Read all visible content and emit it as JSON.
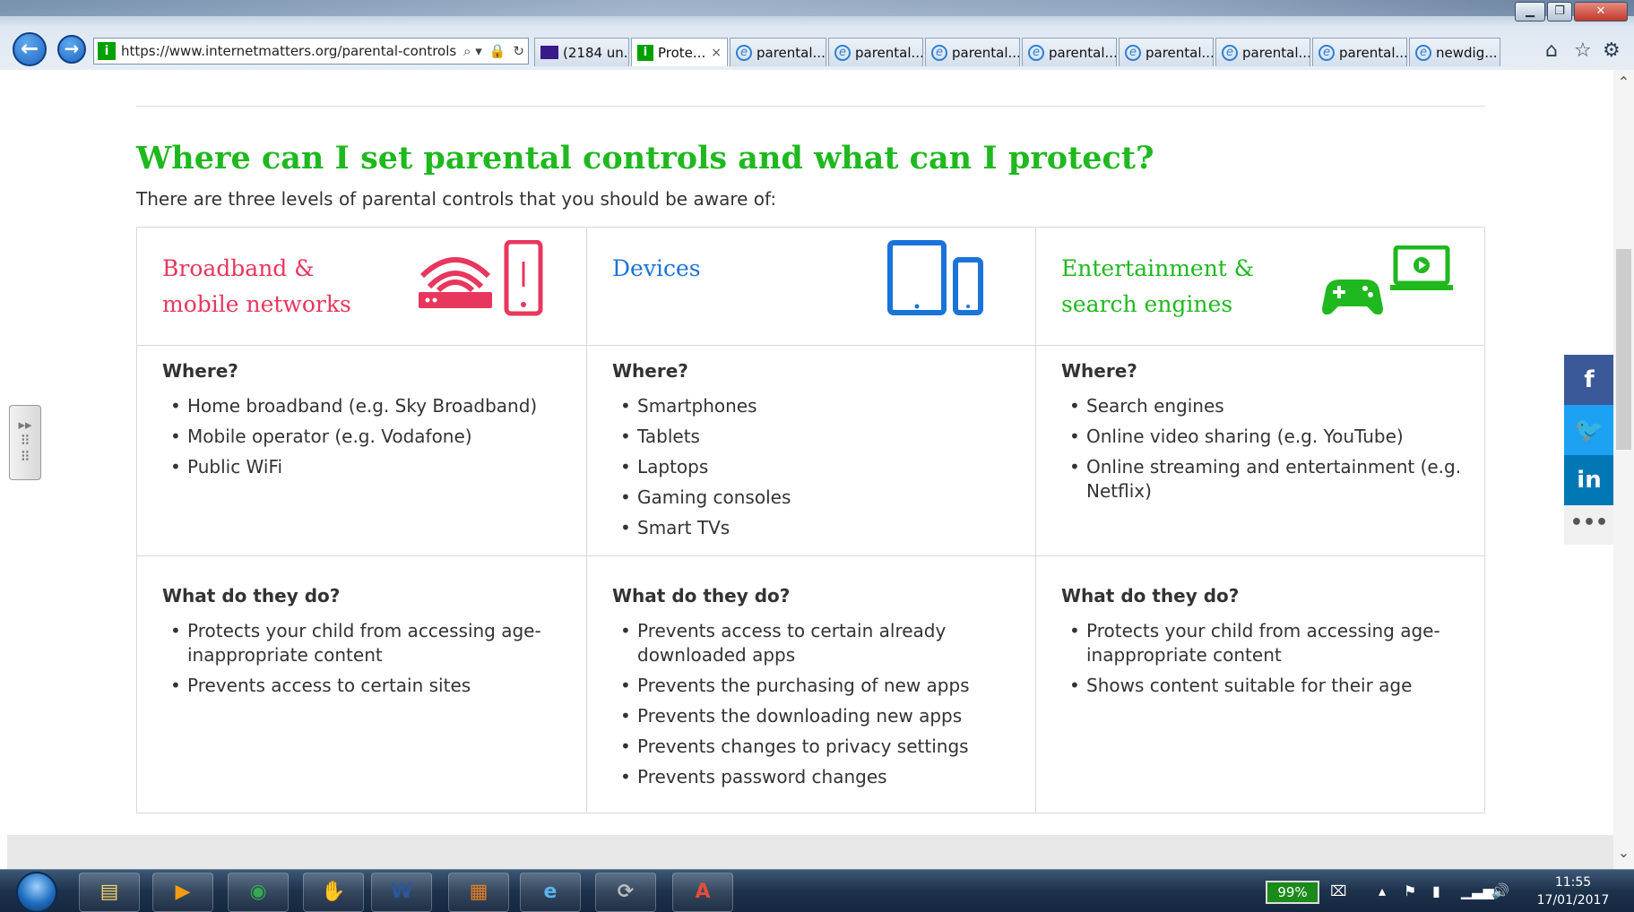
{
  "browser": {
    "address": "https://www.internetmatters.org/parental-controls",
    "tabs": [
      {
        "label": "(2184 un...",
        "icon": "mail-icon"
      },
      {
        "label": "Prote...",
        "icon": "site-icon",
        "active": true
      },
      {
        "label": "parental...",
        "icon": "ie-page-icon"
      },
      {
        "label": "parental...",
        "icon": "ie-page-icon"
      },
      {
        "label": "parental...",
        "icon": "ie-page-icon"
      },
      {
        "label": "parental...",
        "icon": "ie-page-icon"
      },
      {
        "label": "parental...",
        "icon": "ie-page-icon"
      },
      {
        "label": "parental...",
        "icon": "ie-page-icon"
      },
      {
        "label": "parental...",
        "icon": "ie-page-icon"
      },
      {
        "label": "newdig...",
        "icon": "ie-page-icon"
      }
    ],
    "tab_close": "×"
  },
  "page": {
    "heading": "Where can I set parental controls and what can I protect?",
    "intro": "There are three levels of parental controls that you should be aware of:",
    "where_label": "Where?",
    "what_label": "What do they do?",
    "columns": [
      {
        "title_line1": "Broadband &",
        "title_line2": "mobile networks",
        "color": "#e8365d",
        "where": [
          "Home broadband (e.g. Sky Broadband)",
          "Mobile operator (e.g. Vodafone)",
          "Public WiFi"
        ],
        "what": [
          "Protects your child from accessing age-inappropriate content",
          "Prevents access to certain sites"
        ]
      },
      {
        "title_line1": "Devices",
        "title_line2": "",
        "color": "#1a73d8",
        "where": [
          "Smartphones",
          "Tablets",
          "Laptops",
          "Gaming consoles",
          "Smart TVs"
        ],
        "what": [
          "Prevents access to certain already downloaded apps",
          "Prevents the purchasing of new apps",
          "Prevents the downloading new apps",
          "Prevents changes to privacy settings",
          "Prevents password changes"
        ]
      },
      {
        "title_line1": "Entertainment &",
        "title_line2": "search engines",
        "color": "#1fb81f",
        "where": [
          "Search engines",
          "Online video sharing (e.g. YouTube)",
          "Online streaming and entertainment (e.g. Netflix)"
        ],
        "what": [
          "Protects your child from accessing age-inappropriate content",
          "Shows content suitable for their age"
        ]
      }
    ]
  },
  "share": {
    "facebook": "f",
    "twitter": "🐦",
    "linkedin": "in",
    "more": "•••",
    "colors": {
      "facebook": "#3b5998",
      "twitter": "#1da1f2",
      "linkedin": "#0077b5"
    }
  },
  "taskbar": {
    "battery": "99%",
    "time": "11:55",
    "date": "17/01/2017"
  }
}
